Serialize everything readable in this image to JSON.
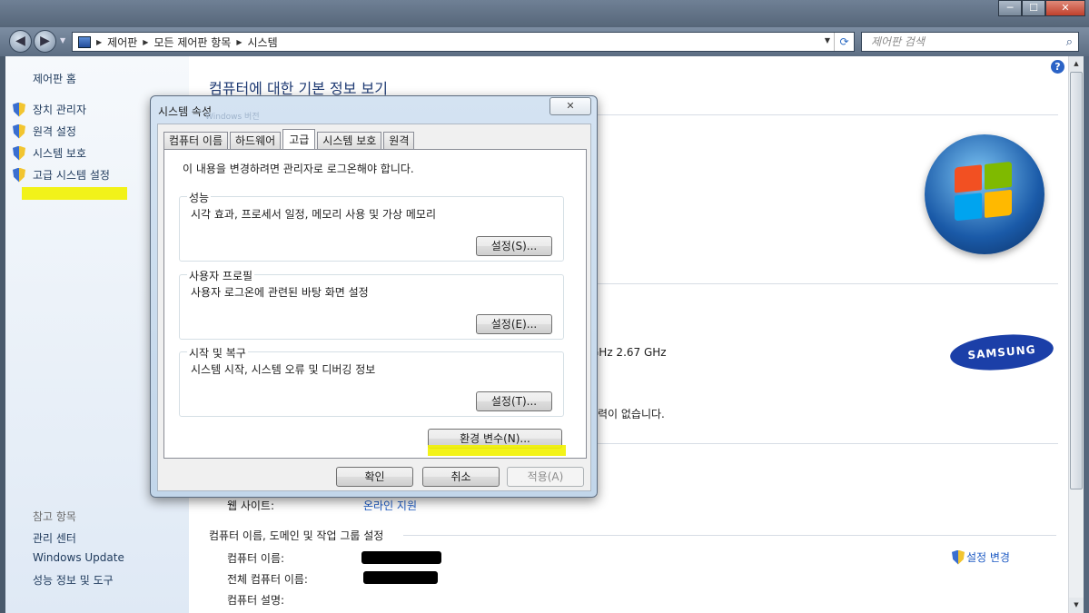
{
  "window": {
    "min": "─",
    "max": "☐",
    "close": "✕"
  },
  "address": {
    "breadcrumb": [
      "제어판",
      "모든 제어판 항목",
      "시스템"
    ],
    "search_placeholder": "제어판 검색"
  },
  "sidebar": {
    "home": "제어판 홈",
    "items": [
      {
        "label": "장치 관리자",
        "icon": "shield-icon"
      },
      {
        "label": "원격 설정",
        "icon": "shield-icon"
      },
      {
        "label": "시스템 보호",
        "icon": "shield-icon"
      },
      {
        "label": "고급 시스템 설정",
        "icon": "shield-icon"
      }
    ],
    "see_also": "참고 항목",
    "links": [
      "관리 센터",
      "Windows Update",
      "성능 정보 및 도구"
    ]
  },
  "main": {
    "title": "컴퓨터에 대한 기본 정보 보기",
    "cpu_speed": "GHz   2.67 GHz",
    "pen_touch": "력이 없습니다.",
    "website_label": "웹 사이트:",
    "website_value": "온라인 지원",
    "section_name": "컴퓨터 이름, 도메인 및 작업 그룹 설정",
    "computer_name_label": "컴퓨터 이름:",
    "full_name_label": "전체 컴퓨터 이름:",
    "description_label": "컴퓨터 설명:",
    "change_settings": "설정 변경",
    "oem_logo": "SAMSUNG"
  },
  "dialog": {
    "title": "시스템 속성",
    "title_ghost": "Windows 버전",
    "tabs": [
      "컴퓨터 이름",
      "하드웨어",
      "고급",
      "시스템 보호",
      "원격"
    ],
    "active_tab": "고급",
    "note": "이 내용을 변경하려면 관리자로 로그온해야 합니다.",
    "groups": [
      {
        "title": "성능",
        "desc": "시각 효과, 프로세서 일정, 메모리 사용 및 가상 메모리",
        "button": "설정(S)..."
      },
      {
        "title": "사용자 프로필",
        "desc": "사용자 로그온에 관련된 바탕 화면 설정",
        "button": "설정(E)..."
      },
      {
        "title": "시작 및 복구",
        "desc": "시스템 시작, 시스템 오류 및 디버깅 정보",
        "button": "설정(T)..."
      }
    ],
    "env_button": "환경 변수(N)...",
    "ok": "확인",
    "cancel": "취소",
    "apply": "적용(A)"
  },
  "colors": {
    "highlight": "#f2f200",
    "link": "#1e5bc4",
    "title": "#1e3a73"
  }
}
